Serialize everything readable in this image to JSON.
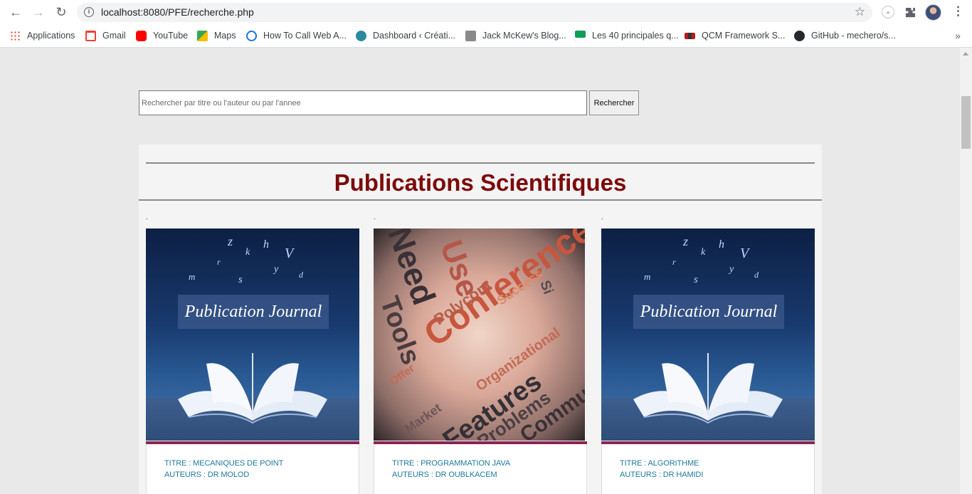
{
  "browser": {
    "url": "localhost:8080/PFE/recherche.php",
    "bookmarks": [
      {
        "label": "Applications",
        "icon": "apps-grid-icon",
        "color": "#4285f4"
      },
      {
        "label": "Gmail",
        "icon": "gmail-icon",
        "color": "#ea4335"
      },
      {
        "label": "YouTube",
        "icon": "youtube-icon",
        "color": "#ff0000"
      },
      {
        "label": "Maps",
        "icon": "maps-icon",
        "color": "#34a853"
      },
      {
        "label": "How To Call Web A...",
        "icon": "web-api-icon",
        "color": "#1a73e8"
      },
      {
        "label": "Dashboard ‹ Créati...",
        "icon": "dashboard-icon",
        "color": "#2b8a9e"
      },
      {
        "label": "Jack McKew's Blog...",
        "icon": "blog-icon",
        "color": "#8a8a8a"
      },
      {
        "label": "Les 40 principales q...",
        "icon": "doc-icon",
        "color": "#0f9d58"
      },
      {
        "label": "QCM Framework S...",
        "icon": "qcm-icon",
        "color": "#b71c1c"
      },
      {
        "label": "GitHub - mechero/s...",
        "icon": "github-icon",
        "color": "#24292e"
      }
    ]
  },
  "search": {
    "placeholder": "Rechercher par titre ou l'auteur ou par l'annee",
    "button_label": "Rechercher"
  },
  "publications": {
    "heading": "Publications Scientifiques",
    "heading_color": "#7d0a0a",
    "items": [
      {
        "marker": ".",
        "image": "journal",
        "image_text": "Publication Journal",
        "title": "TITRE : MECANIQUES DE POINT",
        "authors": "AUTEURS : DR MOLOD"
      },
      {
        "marker": ".",
        "image": "conference",
        "image_text": "Conference",
        "title": "TITRE : PROGRAMMATION JAVA",
        "authors": "AUTEURS : DR OUBLKACEM"
      },
      {
        "marker": ".",
        "image": "journal",
        "image_text": "Publication Journal",
        "title": "TITRE : ALGORITHME",
        "authors": "AUTEURS : DR HAMIDI"
      }
    ]
  }
}
